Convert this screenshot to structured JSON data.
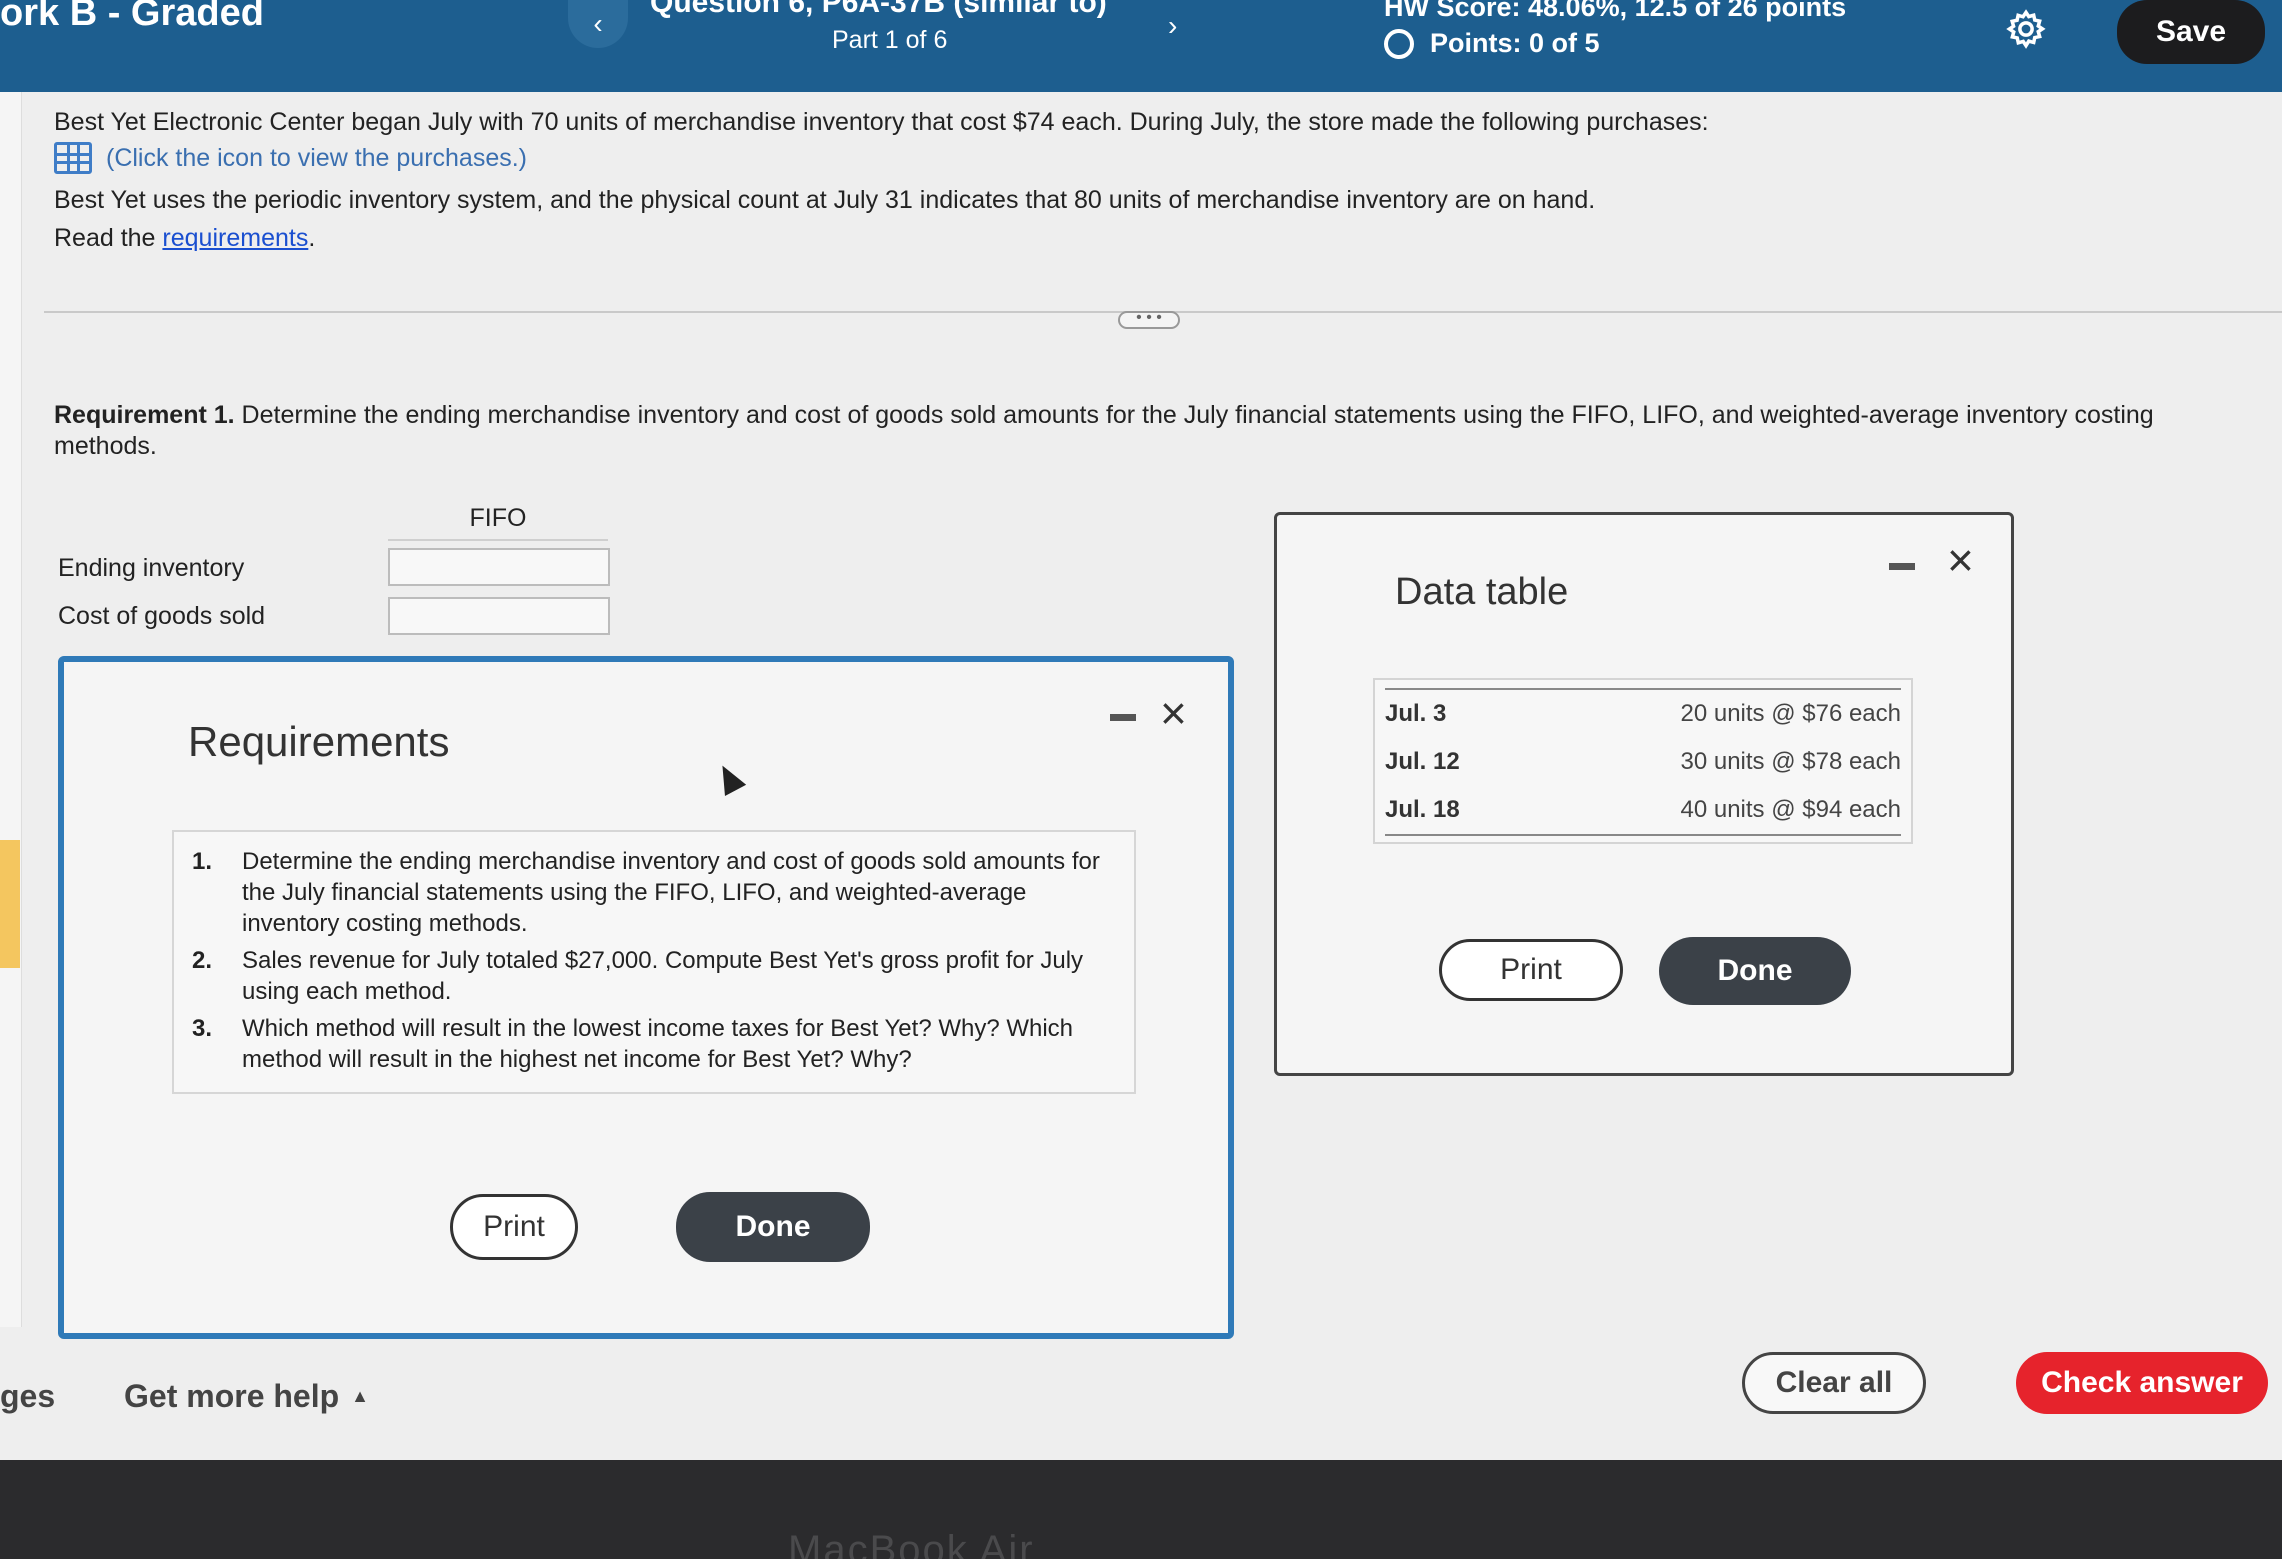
{
  "header": {
    "hw_title": "ork B - Graded",
    "question_title": "Question 6, P6A-37B (similar to)",
    "part_label": "Part 1 of 6",
    "prev_icon": "‹",
    "next_icon": "›",
    "hw_score": "HW Score: 48.06%, 12.5 of 26 points",
    "points": "Points: 0 of 5",
    "save_label": "Save",
    "gear": "gear-icon"
  },
  "question": {
    "line1": "Best Yet Electronic Center began July with 70 units of merchandise inventory that cost $74 each. During July, the store made the following purchases:",
    "line2": "(Click the icon to view the purchases.)",
    "line3": "Best Yet uses the periodic inventory system, and the physical count at July 31 indicates that 80 units of merchandise inventory are on hand.",
    "line4_prefix": "Read the ",
    "line4_link": "requirements",
    "line4_suffix": "."
  },
  "divider_handle": "• • •",
  "requirement1": {
    "bold": "Requirement 1.",
    "text": " Determine the ending merchandise inventory and cost of goods sold amounts for the July financial statements using the FIFO, LIFO, and weighted-average inventory costing methods."
  },
  "answer_table": {
    "column": "FIFO",
    "rows": [
      "Ending inventory",
      "Cost of goods sold"
    ]
  },
  "requirements_modal": {
    "title": "Requirements",
    "items": [
      {
        "num": "1.",
        "text": "Determine the ending merchandise inventory and cost of goods sold amounts for the July financial statements using the FIFO, LIFO, and weighted-average inventory costing methods."
      },
      {
        "num": "2.",
        "text": "Sales revenue for July totaled $27,000. Compute Best Yet's gross profit for July using each method."
      },
      {
        "num": "3.",
        "text": "Which method will result in the lowest income taxes for Best Yet? Why? Which method will result in the highest net income for Best Yet? Why?"
      }
    ],
    "print_label": "Print",
    "done_label": "Done",
    "close_icon": "×"
  },
  "data_modal": {
    "title": "Data table",
    "rows": [
      {
        "date": "Jul. 3",
        "value": "20 units @ $76 each"
      },
      {
        "date": "Jul. 12",
        "value": "30 units @ $78 each"
      },
      {
        "date": "Jul. 18",
        "value": "40 units @ $94 each"
      }
    ],
    "print_label": "Print",
    "done_label": "Done",
    "close_icon": "×"
  },
  "footer": {
    "pages_label": "ges",
    "help_label": "Get more help",
    "help_caret": "▲",
    "clear_label": "Clear all",
    "check_label": "Check answer"
  },
  "device_label": "MacBook Air"
}
